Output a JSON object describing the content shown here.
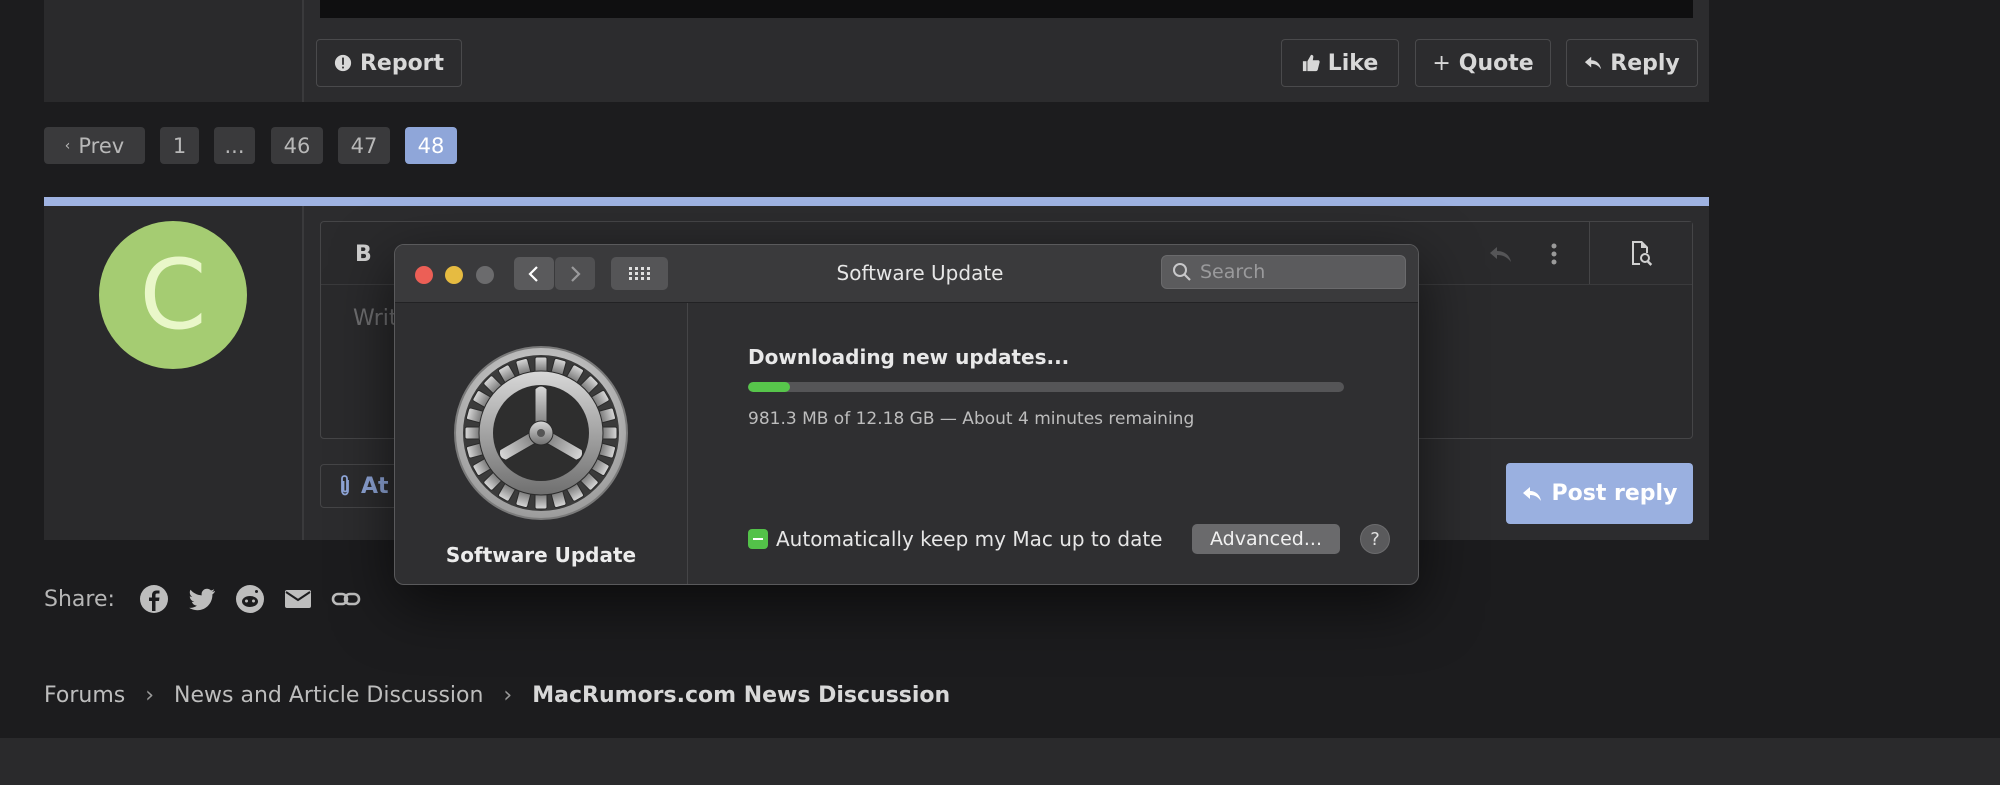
{
  "post_actions": {
    "report_label": "Report",
    "like_label": "Like",
    "quote_label": "Quote",
    "reply_label": "Reply"
  },
  "pagination": {
    "prev_label": "Prev",
    "pages": [
      "1",
      "...",
      "46",
      "47",
      "48"
    ],
    "current": "48"
  },
  "reply": {
    "avatar_letter": "C",
    "bold_label": "B",
    "placeholder": "Writ",
    "attach_label": "At",
    "post_reply_label": "Post reply"
  },
  "share": {
    "label": "Share:",
    "icons": [
      "facebook-icon",
      "twitter-icon",
      "reddit-icon",
      "email-icon",
      "link-icon"
    ]
  },
  "breadcrumb": {
    "items": [
      "Forums",
      "News and Article Discussion"
    ],
    "current": "MacRumors.com News Discussion"
  },
  "software_update": {
    "window_title": "Software Update",
    "search_placeholder": "Search",
    "sidebar_label": "Software Update",
    "status": "Downloading new updates...",
    "progress_fraction": 0.07,
    "detail": "981.3 MB of 12.18 GB — About 4 minutes remaining",
    "auto_update_label": "Automatically keep my Mac up to date",
    "auto_update_checked": true,
    "advanced_label": "Advanced...",
    "help_label": "?"
  },
  "colors": {
    "accent": "#8fa6d9",
    "progress": "#57c54b",
    "traffic_close": "#ec5f56",
    "traffic_minimize": "#e6bb41",
    "traffic_zoom": "#6b6b6d"
  }
}
